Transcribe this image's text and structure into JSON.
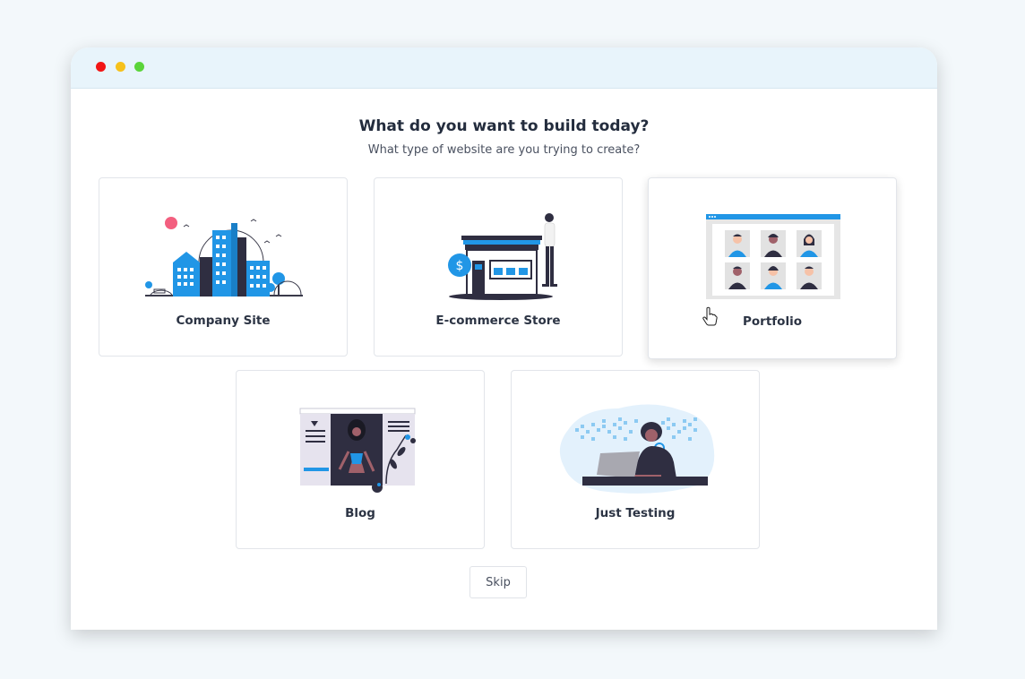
{
  "window": {
    "controls": [
      "close",
      "minimize",
      "maximize"
    ]
  },
  "header": {
    "title": "What do you want to build today?",
    "subtitle": "What type of website are you trying to create?"
  },
  "options": [
    {
      "label": "Company Site",
      "icon": "city-buildings-illustration"
    },
    {
      "label": "E-commerce Store",
      "icon": "storefront-illustration"
    },
    {
      "label": "Portfolio",
      "icon": "profile-grid-illustration"
    },
    {
      "label": "Blog",
      "icon": "blog-page-illustration"
    },
    {
      "label": "Just Testing",
      "icon": "laptop-person-illustration"
    }
  ],
  "skip_label": "Skip",
  "colors": {
    "accent": "#2196e6",
    "dark": "#2f2e41",
    "title": "#232c3d"
  }
}
